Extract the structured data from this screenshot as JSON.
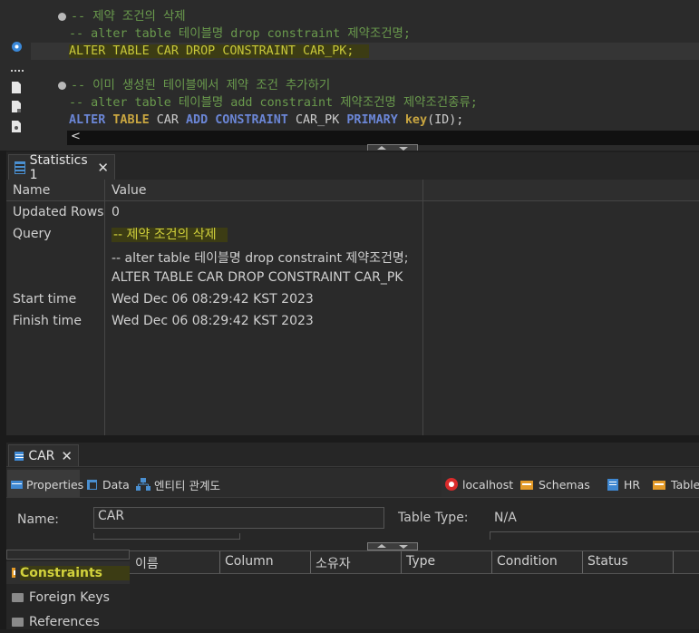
{
  "editor": {
    "line1_comment": "-- 제약 조건의 삭제",
    "line2_comment": "-- alter table 테이블명 drop constraint 제약조건명;",
    "line3": {
      "k1": "ALTER",
      "k2": "TABLE",
      "t1": "CAR",
      "k3": "DROP",
      "k4": "CONSTRAINT",
      "t2": "CAR_PK;"
    },
    "line4_comment": "-- 이미 생성된 테이블에서 제약 조건 추가하기",
    "line5_comment": "-- alter table 테이블명 add constraint 제약조건명 제약조건종류;",
    "line6": {
      "k1": "ALTER",
      "k2": "TABLE",
      "t1": "CAR",
      "k3": "ADD",
      "k4": "CONSTRAINT",
      "t2": "CAR_PK",
      "k5": "PRIMARY",
      "k6": "key",
      "t3": "(ID);"
    },
    "scroll_left": "<"
  },
  "stats": {
    "tab_label": "Statistics 1",
    "close": "✕",
    "headers": {
      "name": "Name",
      "value": "Value"
    },
    "rows": [
      {
        "name": "Updated Rows",
        "value": "0"
      },
      {
        "name": "Query",
        "value": "-- 제약 조건의 삭제"
      },
      {
        "name": "",
        "value": "-- alter table 테이블명 drop constraint 제약조건명;"
      },
      {
        "name": "",
        "value": "ALTER TABLE CAR DROP CONSTRAINT CAR_PK"
      },
      {
        "name": "Start time",
        "value": "Wed Dec 06 08:29:42 KST 2023"
      },
      {
        "name": "Finish time",
        "value": "Wed Dec 06 08:29:42 KST 2023"
      }
    ]
  },
  "bottom": {
    "tab_label": "CAR",
    "close": "✕",
    "tabs": [
      "Properties",
      "Data",
      "엔티티 관계도"
    ],
    "crumbs": [
      "localhost",
      "Schemas",
      "HR",
      "Tables"
    ],
    "name_label": "Name:",
    "name_value": "CAR",
    "type_label": "Table Type:",
    "type_value": "N/A",
    "columns": [
      "이름",
      "Column",
      "소유자",
      "Type",
      "Condition",
      "Status"
    ],
    "left_items": [
      "Constraints",
      "Foreign Keys",
      "References"
    ]
  }
}
